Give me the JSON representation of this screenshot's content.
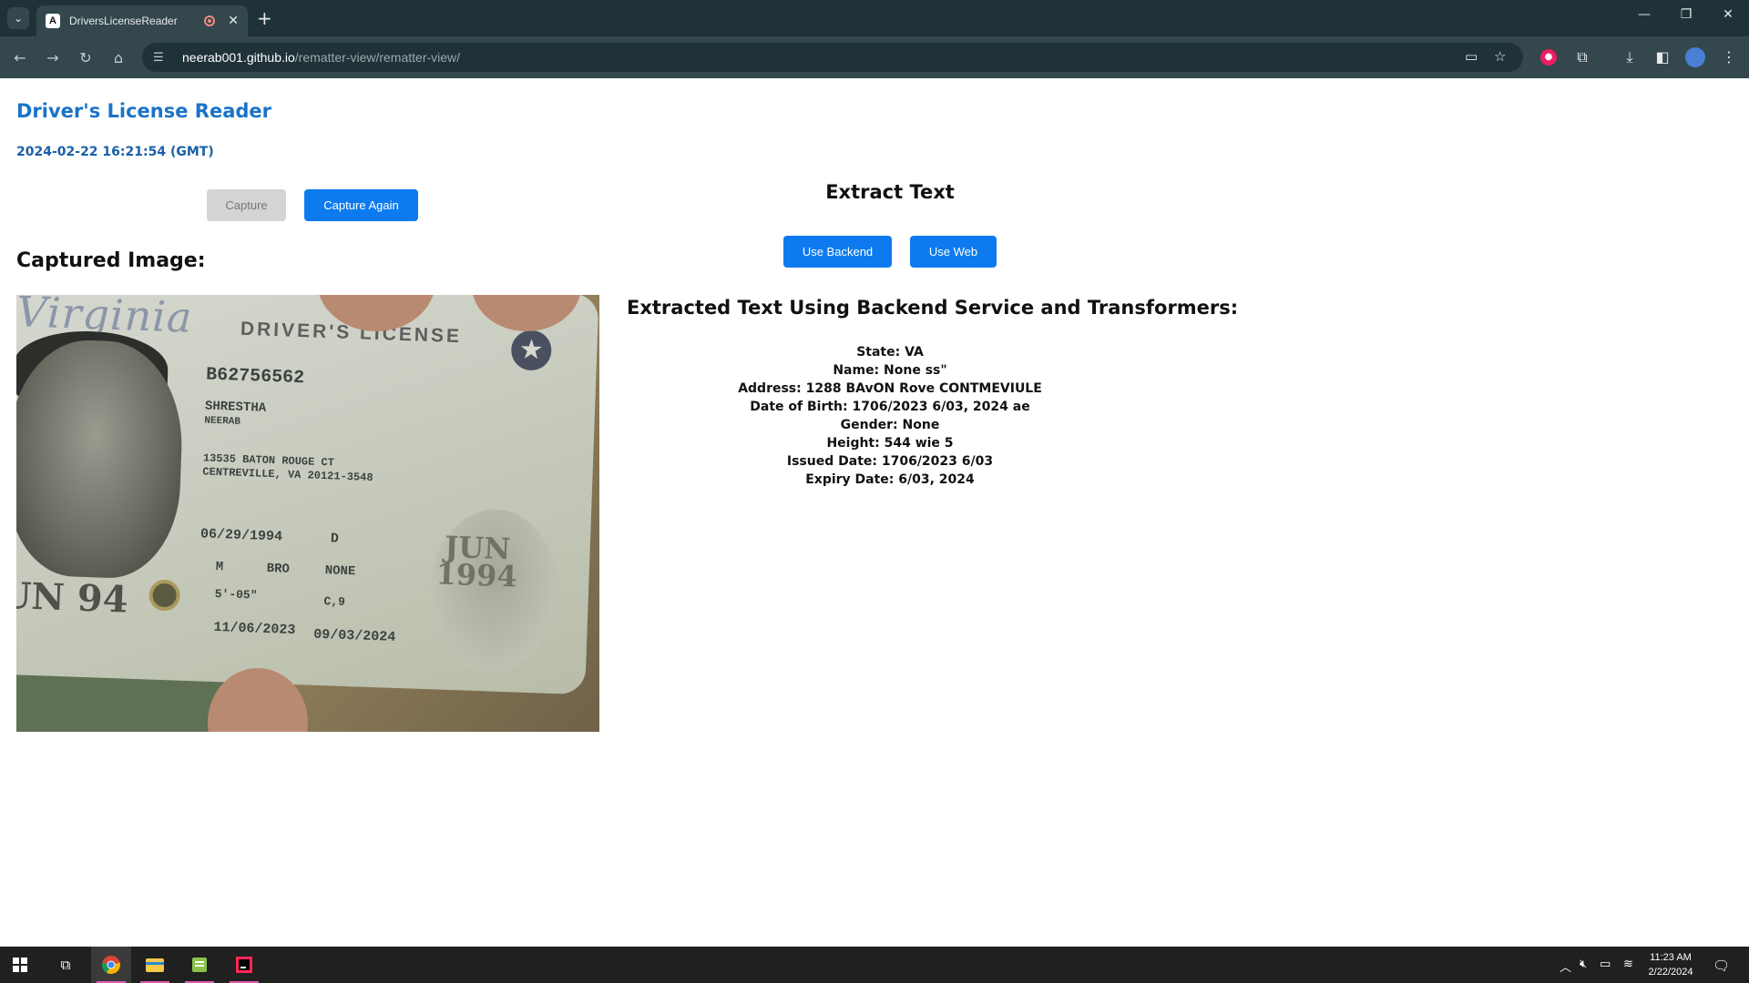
{
  "browser": {
    "tab_title": "DriversLicenseReader",
    "tab_favicon_letter": "A",
    "new_tab_glyph": "+",
    "url_host": "neerab001.github.io",
    "url_path": "/rematter-view/rematter-view/"
  },
  "page": {
    "title": "Driver's License Reader",
    "timestamp": "2024-02-22 16:21:54 (GMT)",
    "capture_label": "Capture",
    "capture_again_label": "Capture Again",
    "captured_image_heading": "Captured Image:",
    "extract_heading": "Extract Text",
    "use_backend_label": "Use Backend",
    "use_web_label": "Use Web",
    "result_heading": "Extracted Text Using Backend Service and Transformers:",
    "results": [
      "State: VA",
      "Name: None ss\"",
      "Address: 1288 BAvON Rove CONTMEVIULE",
      "Date of Birth: 1706/2023 6/03, 2024 ae",
      "Gender: None",
      "Height: 544 wie 5",
      "Issued Date: 1706/2023 6/03",
      "Expiry Date: 6/03, 2024"
    ]
  },
  "license_image": {
    "state": "Virginia",
    "type": "DRIVER'S LICENSE",
    "number": "B62756562",
    "surname": "SHRESTHA",
    "given_name": "NEERAB",
    "street": "13535 BATON ROUGE CT",
    "city": "CENTREVILLE, VA 20121-3548",
    "dob": "06/29/1994",
    "class": "D",
    "sex": "M",
    "eyes": "BRO",
    "end": "NONE",
    "height": "5'-05\"",
    "restrictions": "C,9",
    "issued": "11/06/2023",
    "expires": "09/03/2024",
    "ghost_month": "JUN",
    "ghost_year": "1994",
    "corner_text": "UN 94"
  },
  "taskbar": {
    "time": "11:23 AM",
    "date": "2/22/2024"
  }
}
